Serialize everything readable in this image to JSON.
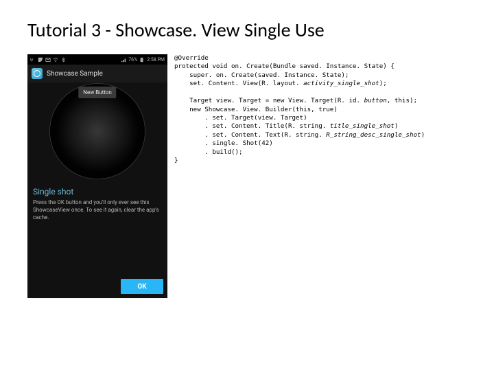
{
  "title": "Tutorial 3 - Showcase. View Single Use",
  "phone": {
    "status": {
      "carrier_icons": [
        "psi",
        "phone",
        "mail",
        "wifi",
        "bt"
      ],
      "signal": "signal",
      "battery": "76%",
      "time": "2:58 PM"
    },
    "appbar_title": "Showcase Sample",
    "new_button": "New Button",
    "overlay_title": "Single shot",
    "overlay_desc": "Press the OK button and you'll only ever see this ShowcaseView once. To see it again, clear the app's cache.",
    "ok_label": "OK"
  },
  "code": {
    "l1": "@Override",
    "l2": "protected void on. Create(Bundle saved. Instance. State) {",
    "l3": "    super. on. Create(saved. Instance. State);",
    "l4a": "    set. Content. View(R. layout. ",
    "l4b": "activity_single_shot",
    "l4c": ");",
    "l5a": "    Target view. Target = new View. Target(R. id. ",
    "l5b": "button",
    "l5c": ", this);",
    "l6": "    new Showcase. View. Builder(this, true)",
    "l7": "        . set. Target(view. Target)",
    "l8a": "        . set. Content. Title(R. string. ",
    "l8b": "title_single_shot",
    "l8c": ")",
    "l9a": "        . set. Content. Text(R. string. ",
    "l9b": "R_string_desc_single_shot",
    "l9c": ")",
    "l10": "        . single. Shot(42)",
    "l11": "        . build();",
    "l12": "}"
  }
}
